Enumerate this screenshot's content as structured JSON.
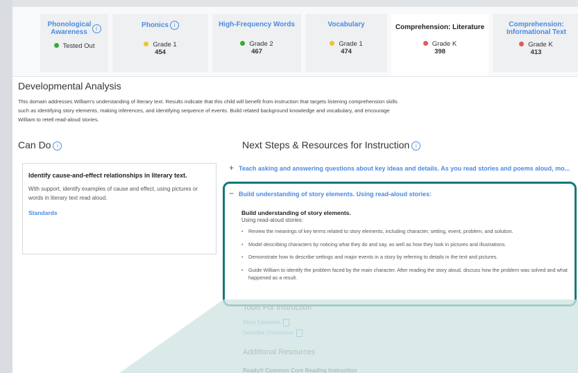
{
  "tabs": [
    {
      "title": "Phonological Awareness",
      "info": "i",
      "status": "Tested Out",
      "score": "",
      "dot": "#3aaa35",
      "active": false
    },
    {
      "title": "Phonics",
      "info": "i",
      "status": "Grade 1",
      "score": "454",
      "dot": "#f1c232",
      "active": false
    },
    {
      "title": "High-Frequency Words",
      "info": "",
      "status": "Grade 2",
      "score": "467",
      "dot": "#3aaa35",
      "active": false
    },
    {
      "title": "Vocabulary",
      "info": "",
      "status": "Grade 1",
      "score": "474",
      "dot": "#f1c232",
      "active": false
    },
    {
      "title": "Comprehension: Literature",
      "info": "",
      "status": "Grade K",
      "score": "398",
      "dot": "#e05a5a",
      "active": true
    },
    {
      "title": "Comprehension: Informational Text",
      "info": "",
      "status": "Grade K",
      "score": "413",
      "dot": "#e05a5a",
      "active": false
    }
  ],
  "analysis": {
    "title": "Developmental Analysis",
    "text": "This domain addresses William's understanding of literary text. Results indicate that this child will benefit from instruction that targets listening comprehension skills such as identifying story elements, making inferences, and identifying sequence of events. Build related background knowledge and vocabulary, and encourage William to retell read-aloud stories."
  },
  "can_do": {
    "title": "Can Do",
    "info": "i",
    "card_title": "Identify cause-and-effect relationships in literary text.",
    "card_text": "With support, identify examples of cause and effect, using pictures or words in literary text read aloud.",
    "link": "Standards"
  },
  "next_steps": {
    "title": "Next Steps & Resources for Instruction",
    "info": "i",
    "items": [
      {
        "symbol": "+",
        "label": "Teach asking and answering questions about key ideas and details. As you read stories and poems aloud, mo..."
      },
      {
        "symbol": "−",
        "label": "Build understanding of story elements. Using read-aloud stories:"
      }
    ],
    "detail": {
      "title": "Build understanding of story elements.",
      "subtitle": "Using read-aloud stories:",
      "bullets": [
        "Review the meanings of key terms related to story elements, including character, setting, event, problem, and solution.",
        "Model describing characters by noticing what they do and say, as well as how they look in pictures and illustrations.",
        "Demonstrate how to describe settings and major events in a story by referring to details in the text and pictures.",
        "Guide William to identify the problem faced by the main character. After reading the story aloud, discuss how the problem was solved and what happened as a result."
      ]
    },
    "tools_title": "Tools For Instruction",
    "tools": [
      "Story Elements",
      "Describe Characters"
    ],
    "additional_title": "Additional Resources",
    "resource": "Ready® Common Core Reading Instruction"
  },
  "colors": {
    "accent": "#4a8be0",
    "highlight": "#137777",
    "teal_fill": "#cfe4e2"
  }
}
